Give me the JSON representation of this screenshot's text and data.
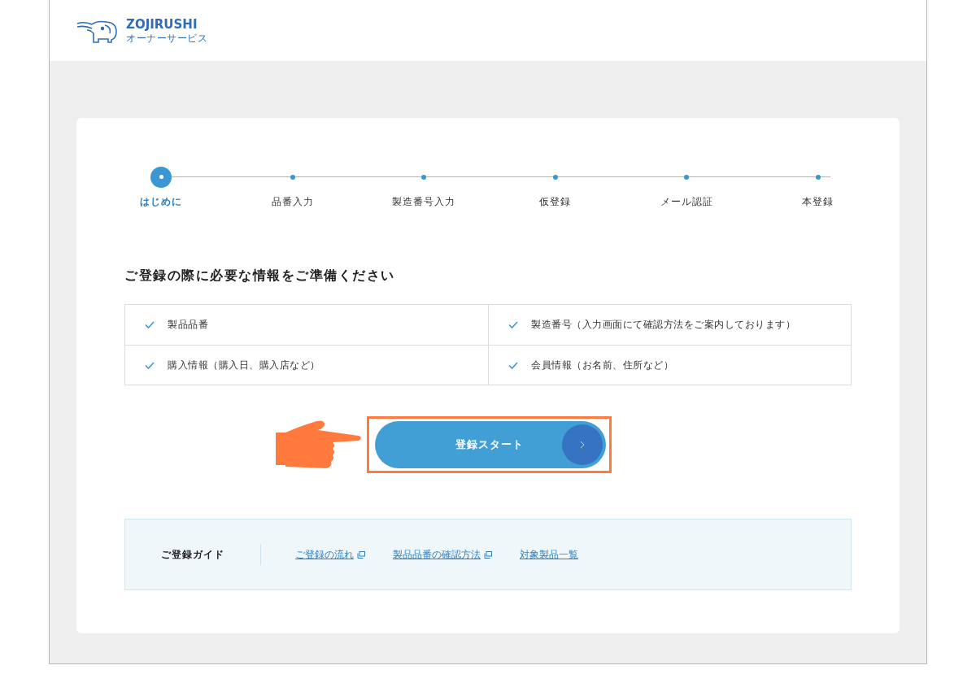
{
  "header": {
    "brand": "ZOJIRUSHI",
    "subtitle": "オーナーサービス"
  },
  "steps": [
    {
      "label": "はじめに",
      "selected": true
    },
    {
      "label": "品番入力",
      "selected": false
    },
    {
      "label": "製造番号入力",
      "selected": false
    },
    {
      "label": "仮登録",
      "selected": false
    },
    {
      "label": "メール認証",
      "selected": false
    },
    {
      "label": "本登録",
      "selected": false
    }
  ],
  "heading": "ご登録の際に必要な情報をご準備ください",
  "requirements": [
    "製品品番",
    "製造番号（入力画面にて確認方法をご案内しております）",
    "購入情報（購入日、購入店など）",
    "会員情報（お名前、住所など）"
  ],
  "start_button": {
    "label": "登録スタート",
    "highlighted": true,
    "pointer": true
  },
  "guide": {
    "title": "ご登録ガイド",
    "links": [
      {
        "label": "ご登録の流れ",
        "external": true
      },
      {
        "label": "製品品番の確認方法",
        "external": true
      },
      {
        "label": "対象製品一覧",
        "external": false
      }
    ]
  }
}
